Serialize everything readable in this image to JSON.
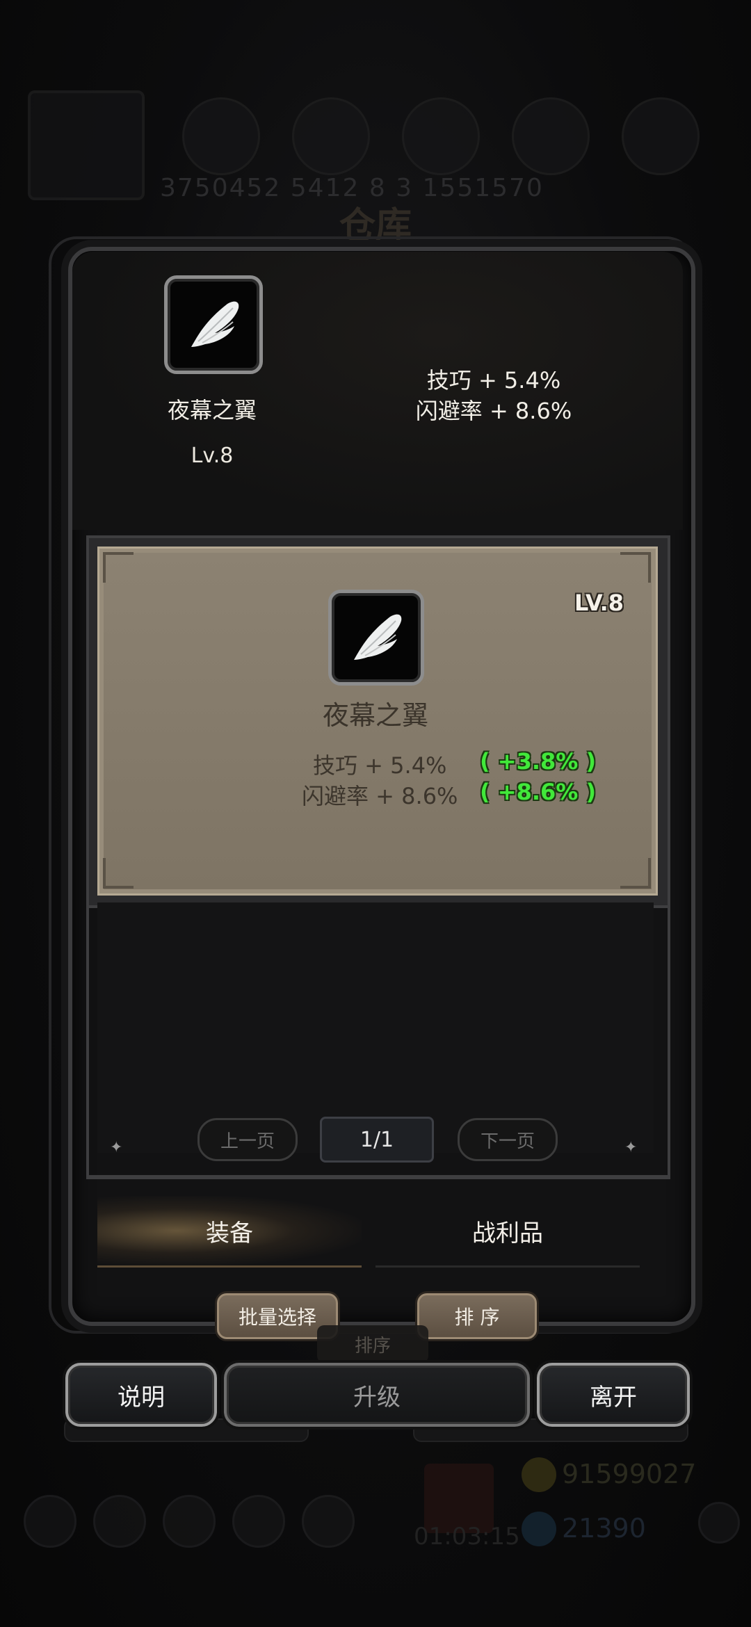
{
  "background_hud": {
    "title": "仓库",
    "numbers": "3750452  5412  8  3  1551570",
    "gold": "91599027",
    "gems": "21390",
    "timer": "01:03:15"
  },
  "summary": {
    "item_name": "夜幕之翼",
    "level": "Lv.8",
    "stats": [
      "技巧 + 5.4%",
      "闪避率 + 8.6%"
    ],
    "icon": "white-wing-icon"
  },
  "card": {
    "level": "LV.8",
    "item_name": "夜幕之翼",
    "stats": [
      "技巧 + 5.4%",
      "闪避率 + 8.6%"
    ],
    "bonuses": [
      "( +3.8% )",
      "( +8.6% )"
    ],
    "bonus_color": "#41e83a"
  },
  "pagination": {
    "prev": "上一页",
    "current": "1/1",
    "next": "下一页"
  },
  "tabs": [
    {
      "label": "装备",
      "active": true
    },
    {
      "label": "战利品",
      "active": false
    }
  ],
  "actions": {
    "batch_select": "批量选择",
    "sort": "排 序",
    "sort_ghost": "排序",
    "info": "说明",
    "upgrade": "升级",
    "leave": "离开"
  }
}
